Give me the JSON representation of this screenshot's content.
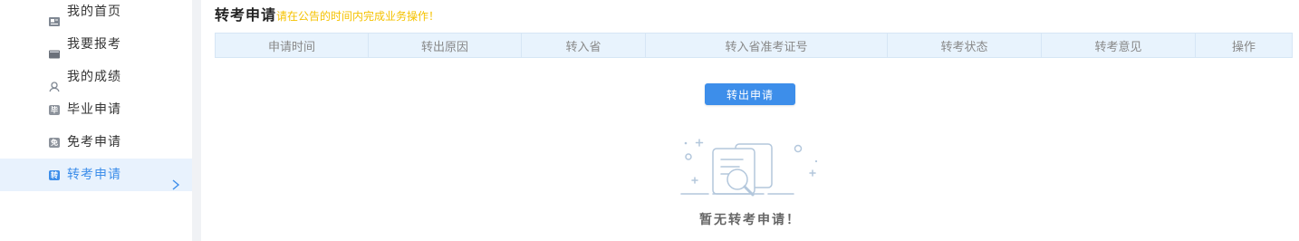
{
  "sidebar": {
    "items": [
      {
        "label": "我的首页",
        "icon": "home-icon"
      },
      {
        "label": "我要报考",
        "icon": "register-icon"
      },
      {
        "label": "我的成绩",
        "icon": "score-icon"
      },
      {
        "label": "毕业申请",
        "icon": "graduation-badge-icon",
        "icon_text": "毕"
      },
      {
        "label": "免考申请",
        "icon": "exemption-badge-icon",
        "icon_text": "免"
      },
      {
        "label": "转考申请",
        "icon": "transfer-badge-icon",
        "icon_text": "转",
        "active": true
      }
    ],
    "active_indicator_icon": "chevron-right-icon"
  },
  "page": {
    "title": "转考申请",
    "notice": "请在公告的时间内完成业务操作！"
  },
  "table": {
    "columns": [
      "申请时间",
      "转出原因",
      "转入省",
      "转入省准考证号",
      "转考状态",
      "转考意见",
      "操作"
    ]
  },
  "actions": {
    "transfer_out_label": "转出申请"
  },
  "empty_state": {
    "icon": "empty-document-search-icon",
    "text": "暂无转考申请！"
  },
  "colors": {
    "accent": "#3d8eea",
    "notice": "#f5c200",
    "header_bg": "#e8f3fd",
    "active_bg": "#e8f2fd",
    "text": "#333333",
    "muted": "#888888"
  }
}
